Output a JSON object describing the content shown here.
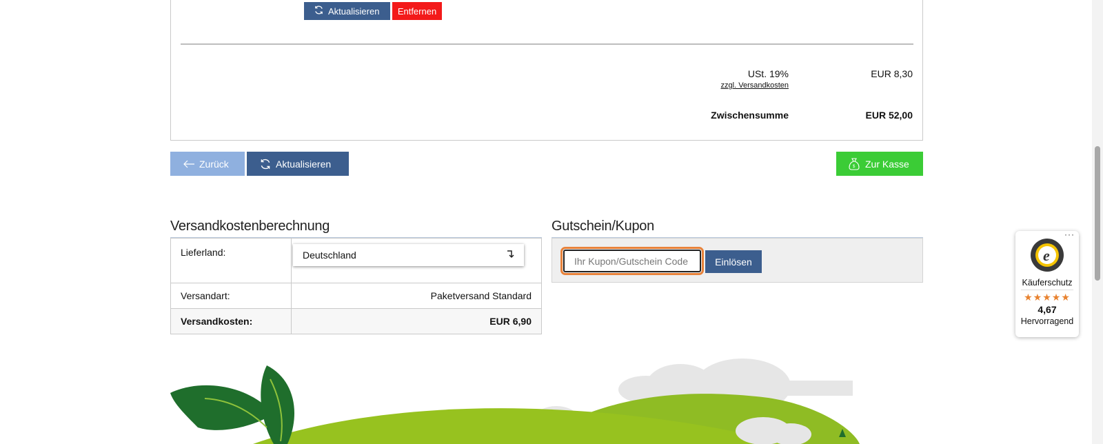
{
  "cart_item": {
    "update_label": "Aktualisieren",
    "remove_label": "Entfernen"
  },
  "totals": {
    "tax_label": "USt. 19%",
    "tax_value": "EUR 8,30",
    "shipping_note": "zzgl. Versandkosten",
    "subtotal_label": "Zwischensumme",
    "subtotal_value": "EUR 52,00"
  },
  "actions": {
    "back_label": "Zurück",
    "update_label": "Aktualisieren",
    "checkout_label": "Zur Kasse"
  },
  "shipping": {
    "title": "Versandkostenberechnung",
    "country_label": "Lieferland:",
    "country_value": "Deutschland",
    "method_label": "Versandart:",
    "method_value": "Paketversand Standard",
    "cost_label": "Versandkosten:",
    "cost_value": "EUR 6,90"
  },
  "coupon": {
    "title": "Gutschein/Kupon",
    "placeholder": "Ihr Kupon/Gutschein Code",
    "redeem_label": "Einlösen"
  },
  "trusted_shops": {
    "caption": "Käuferschutz",
    "stars": "★★★★★",
    "rating": "4,67",
    "grade": "Hervorragend",
    "menu": "···"
  },
  "colors": {
    "primary": "#3c5e8e",
    "danger": "#f31a1a",
    "success": "#3bcc36",
    "back_button": "#8fb0df",
    "focus_outline": "#e8823a"
  },
  "icons": {
    "update": "refresh-icon",
    "back": "arrow-left-icon",
    "checkout": "money-bag-icon",
    "select": "arrow-down-return-icon"
  }
}
